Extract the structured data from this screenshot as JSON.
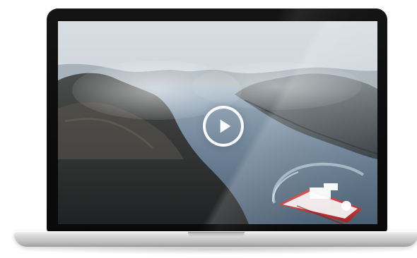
{
  "media": {
    "play_icon": "play-icon"
  },
  "colors": {
    "bezel": "#0b0b0b",
    "play_button_ring": "#ffffff",
    "ship_hull": "#c73b3b",
    "water": "#5b6f84",
    "sky": "#c9d2d8"
  }
}
